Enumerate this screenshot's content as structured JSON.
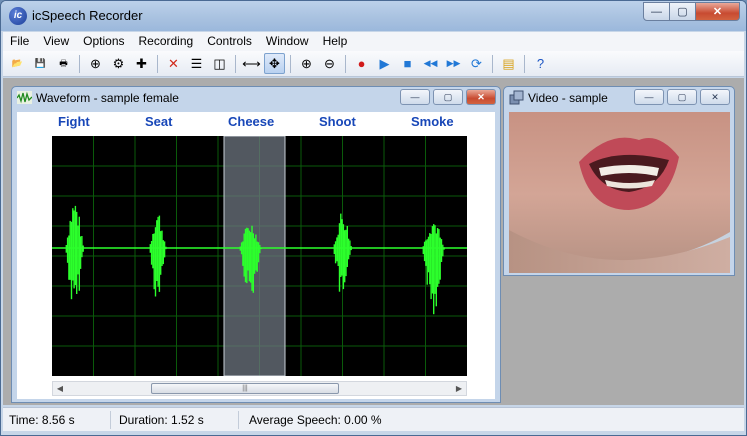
{
  "app": {
    "title": "icSpeech Recorder",
    "icon_letter": "ic"
  },
  "window_controls": {
    "minimize": "—",
    "maximize": "▢",
    "close": "✕"
  },
  "menu": [
    "File",
    "View",
    "Options",
    "Recording",
    "Controls",
    "Window",
    "Help"
  ],
  "toolbar": [
    {
      "name": "open-icon",
      "glyph": "📂"
    },
    {
      "name": "save-icon",
      "glyph": "💾"
    },
    {
      "name": "print-icon",
      "glyph": "🖶"
    },
    {
      "sep": true
    },
    {
      "name": "add-word-icon",
      "glyph": "⊕"
    },
    {
      "name": "word-settings-icon",
      "glyph": "⚙"
    },
    {
      "name": "add-item-icon",
      "glyph": "✚"
    },
    {
      "sep": true
    },
    {
      "name": "delete-icon",
      "glyph": "✕",
      "color": "#d12a1c"
    },
    {
      "name": "split-horizontal-icon",
      "glyph": "☰"
    },
    {
      "name": "split-vertical-icon",
      "glyph": "◫"
    },
    {
      "sep": true
    },
    {
      "name": "fit-width-icon",
      "glyph": "⟷"
    },
    {
      "name": "pan-icon",
      "glyph": "✥",
      "pressed": true
    },
    {
      "sep": true
    },
    {
      "name": "zoom-in-icon",
      "glyph": "⊕"
    },
    {
      "name": "zoom-out-icon",
      "glyph": "⊖"
    },
    {
      "sep": true
    },
    {
      "name": "record-icon",
      "glyph": "●",
      "color": "#d11b1b"
    },
    {
      "name": "play-icon",
      "glyph": "▶",
      "color": "#2178d6"
    },
    {
      "name": "stop-icon",
      "glyph": "■",
      "color": "#2178d6"
    },
    {
      "name": "rewind-icon",
      "glyph": "◀◀",
      "color": "#2178d6"
    },
    {
      "name": "fast-forward-icon",
      "glyph": "▶▶",
      "color": "#2178d6"
    },
    {
      "name": "loop-icon",
      "glyph": "⟳",
      "color": "#2178d6"
    },
    {
      "sep": true
    },
    {
      "name": "notes-icon",
      "glyph": "▤",
      "color": "#d7a21b"
    },
    {
      "sep": true
    },
    {
      "name": "help-icon",
      "glyph": "?",
      "color": "#1d56c4"
    }
  ],
  "waveform": {
    "title": "Waveform - sample female",
    "words": [
      "Fight",
      "Seat",
      "Cheese",
      "Shoot",
      "Smoke"
    ],
    "selected_word": "Cheese",
    "colors": {
      "wave": "#2cff2c",
      "grid": "#0a5a0a",
      "background": "#000000",
      "selection": "#6d7680"
    },
    "scroll_thumb_grip": "|||"
  },
  "video": {
    "title": "Video - sample"
  },
  "status": {
    "time": "Time: 8.56 s",
    "duration": "Duration: 1.52 s",
    "average_speech": "Average Speech: 0.00 %"
  }
}
